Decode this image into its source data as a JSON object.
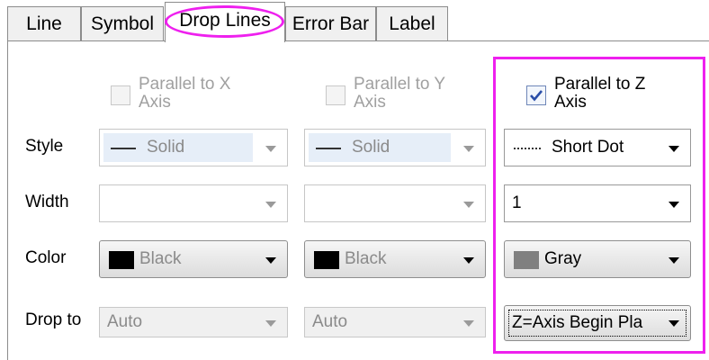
{
  "tabs": [
    {
      "label": "Line"
    },
    {
      "label": "Symbol"
    },
    {
      "label": "Drop Lines"
    },
    {
      "label": "Error Bar"
    },
    {
      "label": "Label"
    }
  ],
  "active_tab": "Drop Lines",
  "rows": {
    "style": "Style",
    "width": "Width",
    "color": "Color",
    "drop_to": "Drop to"
  },
  "columns": [
    {
      "checkbox_label_line1": "Parallel to X",
      "checkbox_label_line2": "Axis",
      "checked": false,
      "enabled": false,
      "style": "Solid",
      "width": "",
      "color": "Black",
      "color_hex": "#000000",
      "drop_to": "Auto"
    },
    {
      "checkbox_label_line1": "Parallel to Y",
      "checkbox_label_line2": "Axis",
      "checked": false,
      "enabled": false,
      "style": "Solid",
      "width": "",
      "color": "Black",
      "color_hex": "#000000",
      "drop_to": "Auto"
    },
    {
      "checkbox_label_line1": "Parallel to Z",
      "checkbox_label_line2": "Axis",
      "checked": true,
      "enabled": true,
      "style": "Short Dot",
      "width": "1",
      "color": "Gray",
      "color_hex": "#808080",
      "drop_to": "Z=Axis Begin Pla"
    }
  ],
  "colors": {
    "highlight": "#ee20ee",
    "check": "#2a4ea8"
  },
  "icons": [
    "chevron-down-icon",
    "checkmark-icon"
  ]
}
